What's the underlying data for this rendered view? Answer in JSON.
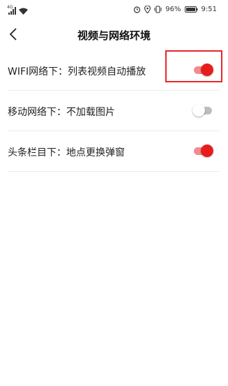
{
  "status_bar": {
    "network_type": "4G",
    "battery_percent": "96%",
    "time": "9:51",
    "icons": [
      "signal-icon",
      "wifi-icon",
      "alarm-icon",
      "location-icon",
      "vibrate-icon",
      "battery-icon"
    ]
  },
  "header": {
    "title": "视频与网络环境",
    "back_icon": "chevron-left-icon"
  },
  "settings": [
    {
      "label": "WIFI网络下：列表视频自动播放",
      "enabled": true,
      "highlighted": true
    },
    {
      "label": "移动网络下：不加载图片",
      "enabled": false,
      "highlighted": false
    },
    {
      "label": "头条栏目下：地点更换弹窗",
      "enabled": true,
      "highlighted": false
    }
  ],
  "colors": {
    "accent": "#e71d1d",
    "track_on": "#f28c8c",
    "track_off": "#bdbdbd",
    "highlight": "#e8262a"
  }
}
